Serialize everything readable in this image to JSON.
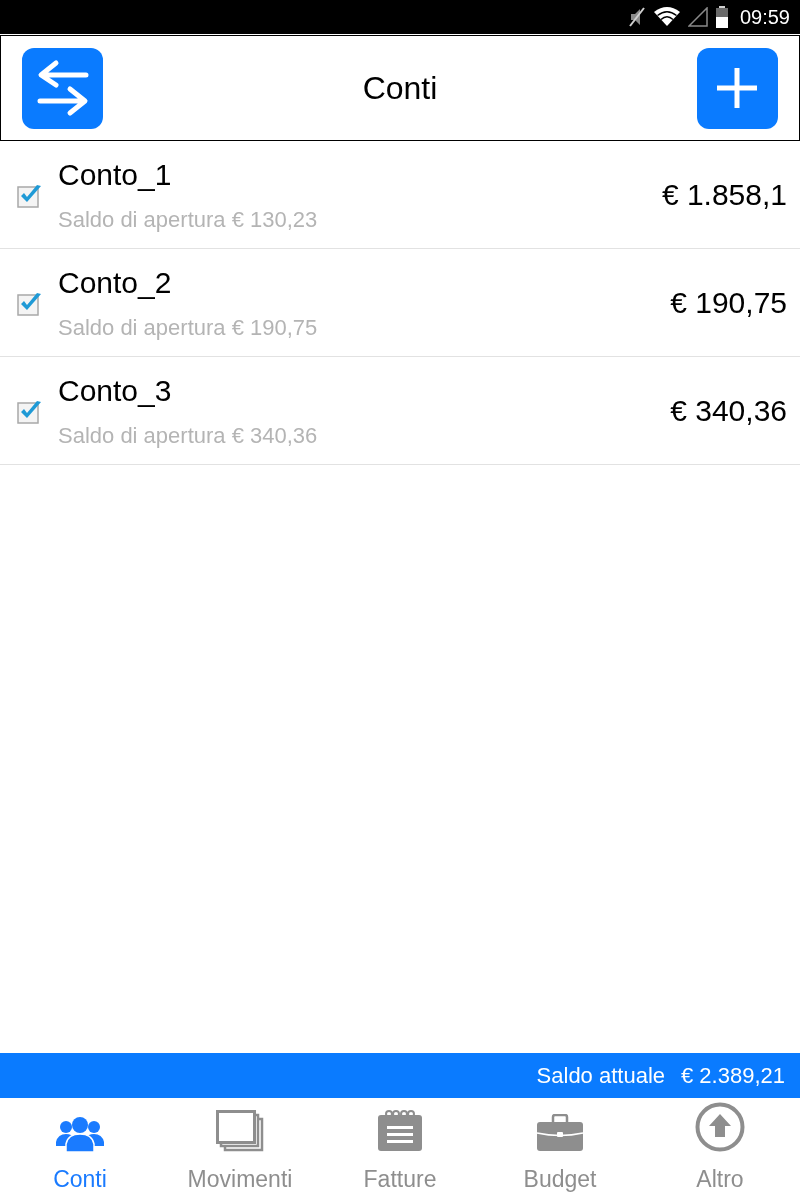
{
  "status_bar": {
    "time": "09:59"
  },
  "header": {
    "title": "Conti"
  },
  "accounts": [
    {
      "name": "Conto_1",
      "subtitle": "Saldo di apertura € 130,23",
      "amount": "€ 1.858,1",
      "checked": true
    },
    {
      "name": "Conto_2",
      "subtitle": "Saldo di apertura € 190,75",
      "amount": "€ 190,75",
      "checked": true
    },
    {
      "name": "Conto_3",
      "subtitle": "Saldo di apertura € 340,36",
      "amount": "€ 340,36",
      "checked": true
    }
  ],
  "balance_bar": {
    "label": "Saldo attuale",
    "amount": "€ 2.389,21"
  },
  "tabs": [
    {
      "label": "Conti",
      "kind": "accounts",
      "selected": true
    },
    {
      "label": "Movimenti",
      "kind": "transactions",
      "selected": false
    },
    {
      "label": "Fatture",
      "kind": "invoices",
      "selected": false
    },
    {
      "label": "Budget",
      "kind": "budget",
      "selected": false
    },
    {
      "label": "Altro",
      "kind": "more",
      "selected": false
    }
  ]
}
